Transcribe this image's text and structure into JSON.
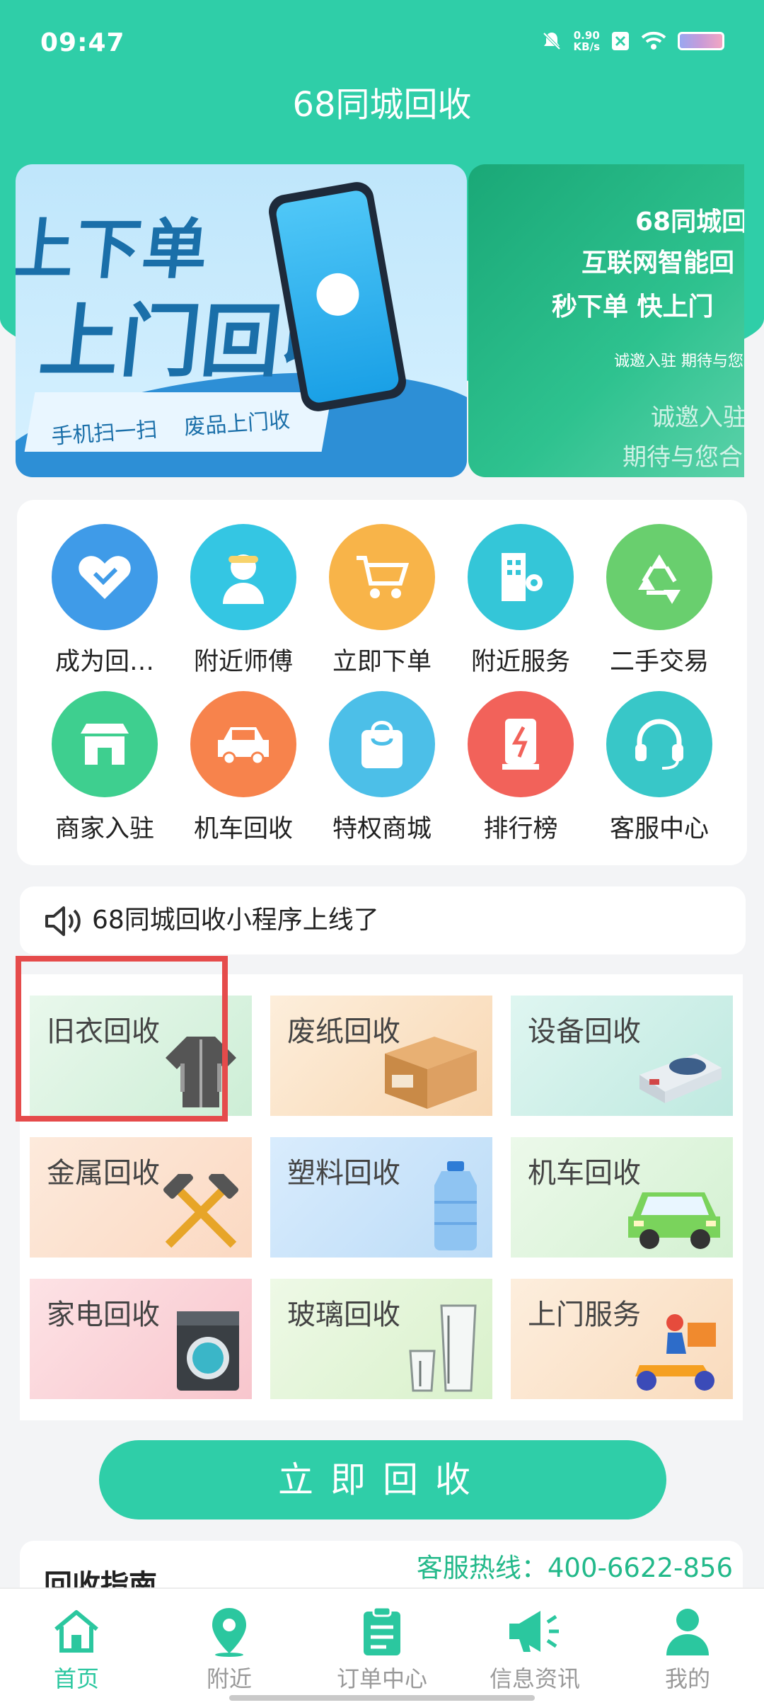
{
  "status": {
    "time": "09:47",
    "speed_value": "0.90",
    "speed_unit": "KB/s"
  },
  "header": {
    "title": "68同城回收"
  },
  "banner_main": {
    "line1": "上下单",
    "line2": "上门回收",
    "sub1": "手机扫一扫",
    "sub2": "废品上门收"
  },
  "banner_side": {
    "l1": "68同城回",
    "l2": "互联网智能回",
    "l3": "秒下单 快上门",
    "l4": "诚邀入驻 期待与您",
    "l5": "诚邀入驻",
    "l6": "期待与您合"
  },
  "menu": [
    {
      "label": "成为回…",
      "icon": "handshake-icon",
      "color": "#3f9be8"
    },
    {
      "label": "附近师傅",
      "icon": "worker-icon",
      "color": "#34c6e3"
    },
    {
      "label": "立即下单",
      "icon": "cart-icon",
      "color": "#f8b449"
    },
    {
      "label": "附近服务",
      "icon": "building-location-icon",
      "color": "#34c6d8"
    },
    {
      "label": "二手交易",
      "icon": "recycle-icon",
      "color": "#69cf6e"
    },
    {
      "label": "商家入驻",
      "icon": "shop-icon",
      "color": "#3ecf8f"
    },
    {
      "label": "机车回收",
      "icon": "car-icon",
      "color": "#f7834c"
    },
    {
      "label": "特权商城",
      "icon": "shopping-bag-icon",
      "color": "#4cbfe8"
    },
    {
      "label": "排行榜",
      "icon": "ranking-icon",
      "color": "#f2625a"
    },
    {
      "label": "客服中心",
      "icon": "headset-icon",
      "color": "#38c7c8"
    }
  ],
  "notice": {
    "text": "68同城回收小程序上线了"
  },
  "categories": [
    {
      "label": "旧衣回收",
      "bg": "#dff4e3",
      "icon": "jacket-icon"
    },
    {
      "label": "废纸回收",
      "bg": "#fbe4c8",
      "icon": "carton-icon"
    },
    {
      "label": "设备回收",
      "bg": "#d2f0ea",
      "icon": "device-icon"
    },
    {
      "label": "金属回收",
      "bg": "#fde3d2",
      "icon": "hammers-icon"
    },
    {
      "label": "塑料回收",
      "bg": "#cfe6fb",
      "icon": "water-bottle-icon"
    },
    {
      "label": "机车回收",
      "bg": "#e2f6e1",
      "icon": "green-car-icon"
    },
    {
      "label": "家电回收",
      "bg": "#fbd6da",
      "icon": "washing-machine-icon"
    },
    {
      "label": "玻璃回收",
      "bg": "#e6f6d9",
      "icon": "glasses-icon"
    },
    {
      "label": "上门服务",
      "bg": "#fde8d2",
      "icon": "delivery-scooter-icon"
    }
  ],
  "actions": {
    "recycle_now": "立即回收"
  },
  "guide": {
    "title": "回收指南",
    "hotline": "客服热线：400-6622-856"
  },
  "tabs": [
    {
      "label": "首页",
      "icon": "home-icon"
    },
    {
      "label": "附近",
      "icon": "location-pin-icon"
    },
    {
      "label": "订单中心",
      "icon": "clipboard-icon"
    },
    {
      "label": "信息资讯",
      "icon": "megaphone-icon"
    },
    {
      "label": "我的",
      "icon": "user-icon"
    }
  ],
  "colors": {
    "primary": "#2fcea8",
    "highlight": "#e54b4b"
  }
}
